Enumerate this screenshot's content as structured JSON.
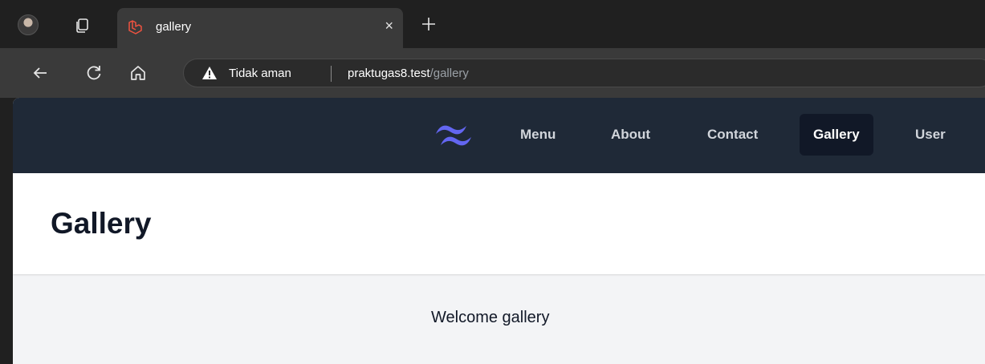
{
  "browser": {
    "tab": {
      "title": "gallery",
      "close_glyph": "×"
    },
    "new_tab_glyph": "+",
    "address": {
      "security_label": "Tidak aman",
      "host": "praktugas8.test",
      "path": "/gallery"
    },
    "icons": {
      "back": "back-arrow-icon",
      "refresh": "refresh-icon",
      "home": "home-icon",
      "warning": "warning-icon",
      "tabs": "tab-actions-icon",
      "favicon": "laravel-logo-icon"
    }
  },
  "site": {
    "nav": {
      "items": [
        {
          "label": "Menu",
          "active": false
        },
        {
          "label": "About",
          "active": false
        },
        {
          "label": "Contact",
          "active": false
        },
        {
          "label": "Gallery",
          "active": true
        },
        {
          "label": "User",
          "active": false
        }
      ]
    },
    "page_title": "Gallery",
    "content": {
      "text": "Welcome gallery"
    }
  },
  "colors": {
    "nav_bg": "#1f2937",
    "nav_active_bg": "#111827",
    "logo_accent": "#6366f1",
    "page_bg": "#f3f4f6"
  }
}
